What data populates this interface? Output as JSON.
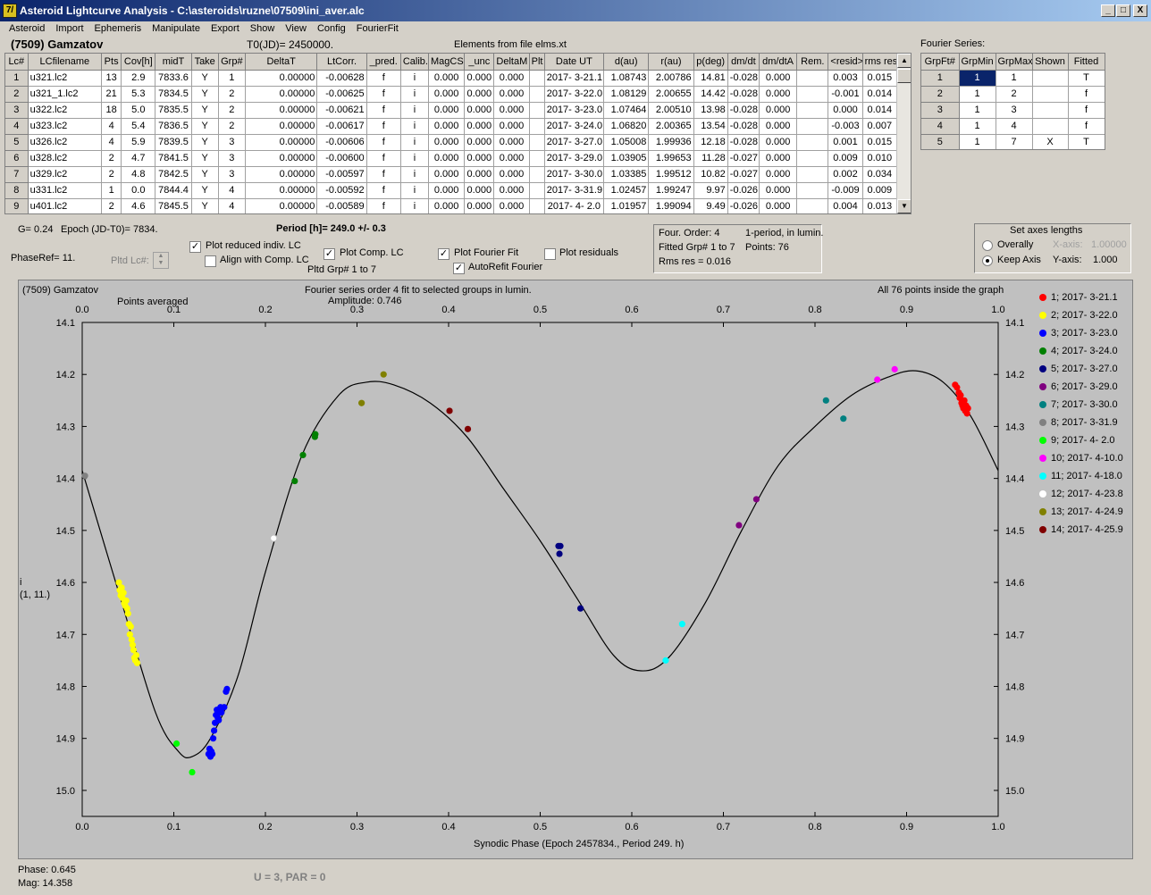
{
  "title": "Asteroid Lightcurve Analysis - C:\\asteroids\\ruzne\\07509\\ini_aver.alc",
  "app_icon": "7/",
  "window_buttons": [
    "_",
    "□",
    "X"
  ],
  "menu": [
    "Asteroid",
    "Import",
    "Ephemeris",
    "Manipulate",
    "Export",
    "Show",
    "View",
    "Config",
    "FourierFit"
  ],
  "asteroid_name": "(7509) Gamzatov",
  "t0": "T0(JD)= 2450000.",
  "elements": "Elements from file elms.xt",
  "fourier_series_label": "Fourier Series:",
  "lc_table": {
    "headers": [
      "Lc#",
      "LCfilename",
      "Pts",
      "Cov[h]",
      "midT",
      "Take",
      "Grp#",
      "DeltaT",
      "LtCorr.",
      "_pred.",
      "Calib.",
      "MagCS",
      "_unc",
      "DeltaM",
      "Plt",
      "Date UT",
      "d(au)",
      "r(au)",
      "p(deg)",
      "dm/dt",
      "dm/dtA",
      "Rem.",
      "<resid>",
      "rms res"
    ],
    "rows": [
      [
        "1",
        "u321.lc2",
        "13",
        "2.9",
        "7833.6",
        "Y",
        "1",
        "0.00000",
        "-0.00628",
        "f",
        "i",
        "0.000",
        "0.000",
        "0.000",
        "",
        "2017- 3-21.1",
        "1.08743",
        "2.00786",
        "14.81",
        "-0.028",
        "0.000",
        "",
        "0.003",
        "0.015"
      ],
      [
        "2",
        "u321_1.lc2",
        "21",
        "5.3",
        "7834.5",
        "Y",
        "2",
        "0.00000",
        "-0.00625",
        "f",
        "i",
        "0.000",
        "0.000",
        "0.000",
        "",
        "2017- 3-22.0",
        "1.08129",
        "2.00655",
        "14.42",
        "-0.028",
        "0.000",
        "",
        "-0.001",
        "0.014"
      ],
      [
        "3",
        "u322.lc2",
        "18",
        "5.0",
        "7835.5",
        "Y",
        "2",
        "0.00000",
        "-0.00621",
        "f",
        "i",
        "0.000",
        "0.000",
        "0.000",
        "",
        "2017- 3-23.0",
        "1.07464",
        "2.00510",
        "13.98",
        "-0.028",
        "0.000",
        "",
        "0.000",
        "0.014"
      ],
      [
        "4",
        "u323.lc2",
        "4",
        "5.4",
        "7836.5",
        "Y",
        "2",
        "0.00000",
        "-0.00617",
        "f",
        "i",
        "0.000",
        "0.000",
        "0.000",
        "",
        "2017- 3-24.0",
        "1.06820",
        "2.00365",
        "13.54",
        "-0.028",
        "0.000",
        "",
        "-0.003",
        "0.007"
      ],
      [
        "5",
        "u326.lc2",
        "4",
        "5.9",
        "7839.5",
        "Y",
        "3",
        "0.00000",
        "-0.00606",
        "f",
        "i",
        "0.000",
        "0.000",
        "0.000",
        "",
        "2017- 3-27.0",
        "1.05008",
        "1.99936",
        "12.18",
        "-0.028",
        "0.000",
        "",
        "0.001",
        "0.015"
      ],
      [
        "6",
        "u328.lc2",
        "2",
        "4.7",
        "7841.5",
        "Y",
        "3",
        "0.00000",
        "-0.00600",
        "f",
        "i",
        "0.000",
        "0.000",
        "0.000",
        "",
        "2017- 3-29.0",
        "1.03905",
        "1.99653",
        "11.28",
        "-0.027",
        "0.000",
        "",
        "0.009",
        "0.010"
      ],
      [
        "7",
        "u329.lc2",
        "2",
        "4.8",
        "7842.5",
        "Y",
        "3",
        "0.00000",
        "-0.00597",
        "f",
        "i",
        "0.000",
        "0.000",
        "0.000",
        "",
        "2017- 3-30.0",
        "1.03385",
        "1.99512",
        "10.82",
        "-0.027",
        "0.000",
        "",
        "0.002",
        "0.034"
      ],
      [
        "8",
        "u331.lc2",
        "1",
        "0.0",
        "7844.4",
        "Y",
        "4",
        "0.00000",
        "-0.00592",
        "f",
        "i",
        "0.000",
        "0.000",
        "0.000",
        "",
        "2017- 3-31.9",
        "1.02457",
        "1.99247",
        "9.97",
        "-0.026",
        "0.000",
        "",
        "-0.009",
        "0.009"
      ],
      [
        "9",
        "u401.lc2",
        "2",
        "4.6",
        "7845.5",
        "Y",
        "4",
        "0.00000",
        "-0.00589",
        "f",
        "i",
        "0.000",
        "0.000",
        "0.000",
        "",
        "2017- 4- 2.0",
        "1.01957",
        "1.99094",
        "9.49",
        "-0.026",
        "0.000",
        "",
        "0.004",
        "0.013"
      ]
    ]
  },
  "fourier_table": {
    "headers": [
      "GrpFt#",
      "GrpMin",
      "GrpMax",
      "Shown",
      "Fitted"
    ],
    "rows": [
      [
        "1",
        "1",
        "1",
        "",
        "T"
      ],
      [
        "2",
        "1",
        "2",
        "",
        "f"
      ],
      [
        "3",
        "1",
        "3",
        "",
        "f"
      ],
      [
        "4",
        "1",
        "4",
        "",
        "f"
      ],
      [
        "5",
        "1",
        "7",
        "X",
        "T"
      ]
    ]
  },
  "info": {
    "g": "G= 0.24",
    "epoch": "Epoch (JD-T0)= 7834.",
    "period": "Period [h]= 249.0 +/- 0.3",
    "phaseref": "PhaseRef= 11.",
    "pltd_lc": "Pltd Lc#:",
    "pltd_grp": "Pltd Grp#  1   to   7"
  },
  "checks": {
    "plot_reduced": {
      "label": "Plot reduced indiv. LC",
      "checked": true
    },
    "align": {
      "label": "Align with Comp. LC",
      "checked": false
    },
    "plot_comp": {
      "label": "Plot Comp. LC",
      "checked": true
    },
    "plot_fourier": {
      "label": "Plot Fourier Fit",
      "checked": true
    },
    "autorefit": {
      "label": "AutoRefit Fourier",
      "checked": true
    },
    "plot_resid": {
      "label": "Plot residuals",
      "checked": false
    }
  },
  "fit_info": {
    "order": "Four. Order:  4",
    "mode": "1-period, in lumin.",
    "fitted": "Fitted Grp# 1 to 7",
    "points": "Points: 76",
    "rms": "Rms res     = 0.016"
  },
  "axes": {
    "title": "Set axes lengths",
    "overally": "Overally",
    "keep": "Keep Axis",
    "xaxis_label": "X-axis:",
    "xaxis_val": "1.00000",
    "yaxis_label": "Y-axis:",
    "yaxis_val": "1.000"
  },
  "plot_header": {
    "name": "(7509) Gamzatov",
    "fourier": "Fourier series order 4 fit to selected groups in lumin.",
    "amplitude": "Amplitude: 0.746",
    "points_in": "All 76 points inside the graph",
    "averaged": "Points averaged"
  },
  "status": {
    "phase": "Phase:  0.645",
    "mag": "Mag:    14.358",
    "upar": "U = 3, PAR = 0"
  },
  "chart_data": {
    "type": "scatter",
    "xlabel": "Synodic Phase (Epoch 2457834., Period 249. h)",
    "ylabel": "i",
    "ylabel2": "(1, 11.)",
    "xlim": [
      0,
      1
    ],
    "ylim": [
      14.1,
      15.05
    ],
    "y_inverted": true,
    "x_ticks": [
      0,
      0.1,
      0.2,
      0.3,
      0.4,
      0.5,
      0.6,
      0.7,
      0.8,
      0.9,
      1.0
    ],
    "x_tick_labels": [
      "0.0",
      "0.1",
      "0.2",
      "0.3",
      "0.4",
      "0.5",
      "0.6",
      "0.7",
      "0.8",
      "0.9",
      "1.0"
    ],
    "y_ticks": [
      14.1,
      14.2,
      14.3,
      14.4,
      14.5,
      14.6,
      14.7,
      14.8,
      14.9,
      15.0
    ],
    "y_tick_labels": [
      "14.1",
      "14.2",
      "14.3",
      "14.4",
      "14.5",
      "14.6",
      "14.7",
      "14.8",
      "14.9",
      "15.0"
    ],
    "fit_curve": {
      "phase": [
        0,
        0.04,
        0.08,
        0.105,
        0.12,
        0.14,
        0.17,
        0.2,
        0.24,
        0.28,
        0.31,
        0.34,
        0.38,
        0.42,
        0.46,
        0.5,
        0.54,
        0.58,
        0.61,
        0.64,
        0.68,
        0.72,
        0.76,
        0.8,
        0.84,
        0.88,
        0.91,
        0.94,
        0.97,
        1.0
      ],
      "mag": [
        14.385,
        14.62,
        14.85,
        14.925,
        14.935,
        14.9,
        14.78,
        14.58,
        14.355,
        14.24,
        14.215,
        14.22,
        14.255,
        14.32,
        14.42,
        14.52,
        14.63,
        14.74,
        14.77,
        14.745,
        14.64,
        14.5,
        14.375,
        14.3,
        14.24,
        14.205,
        14.193,
        14.215,
        14.28,
        14.385
      ]
    },
    "series": [
      {
        "name": "1; 2017- 3-21.1",
        "color": "#ff0000",
        "x": [
          0.953,
          0.955,
          0.957,
          0.958,
          0.959,
          0.96,
          0.961,
          0.962,
          0.963,
          0.964,
          0.965,
          0.966,
          0.967
        ],
        "y": [
          14.22,
          14.225,
          14.235,
          14.245,
          14.24,
          14.255,
          14.26,
          14.265,
          14.25,
          14.27,
          14.26,
          14.275,
          14.265
        ]
      },
      {
        "name": "2; 2017- 3-22.0",
        "color": "#ffff00",
        "x": [
          0.04,
          0.041,
          0.042,
          0.043,
          0.044,
          0.045,
          0.046,
          0.047,
          0.048,
          0.049,
          0.05,
          0.051,
          0.052,
          0.053,
          0.054,
          0.055,
          0.056,
          0.057,
          0.058,
          0.059,
          0.06
        ],
        "y": [
          14.6,
          14.615,
          14.625,
          14.61,
          14.63,
          14.62,
          14.64,
          14.645,
          14.635,
          14.65,
          14.66,
          14.68,
          14.7,
          14.685,
          14.71,
          14.72,
          14.73,
          14.745,
          14.75,
          14.74,
          14.755
        ]
      },
      {
        "name": "3; 2017- 3-23.0",
        "color": "#0000ff",
        "x": [
          0.138,
          0.139,
          0.14,
          0.141,
          0.142,
          0.143,
          0.144,
          0.145,
          0.146,
          0.147,
          0.148,
          0.149,
          0.15,
          0.151,
          0.152,
          0.155,
          0.157,
          0.158
        ],
        "y": [
          14.93,
          14.92,
          14.935,
          14.925,
          14.93,
          14.9,
          14.885,
          14.87,
          14.855,
          14.845,
          14.86,
          14.865,
          14.85,
          14.84,
          14.85,
          14.84,
          14.81,
          14.805
        ]
      },
      {
        "name": "4; 2017- 3-24.0",
        "color": "#008000",
        "x": [
          0.232,
          0.241,
          0.254,
          0.2545
        ],
        "y": [
          14.405,
          14.355,
          14.32,
          14.315
        ]
      },
      {
        "name": "5; 2017- 3-27.0",
        "color": "#000080",
        "x": [
          0.52,
          0.521,
          0.522,
          0.544
        ],
        "y": [
          14.53,
          14.545,
          14.53,
          14.65
        ]
      },
      {
        "name": "6; 2017- 3-29.0",
        "color": "#800080",
        "x": [
          0.717,
          0.736
        ],
        "y": [
          14.49,
          14.44
        ]
      },
      {
        "name": "7; 2017- 3-30.0",
        "color": "#008080",
        "x": [
          0.812,
          0.831
        ],
        "y": [
          14.25,
          14.285
        ]
      },
      {
        "name": "8; 2017- 3-31.9",
        "color": "#808080",
        "x": [
          0.003
        ],
        "y": [
          14.395
        ]
      },
      {
        "name": "9; 2017- 4- 2.0",
        "color": "#00ff00",
        "x": [
          0.103,
          0.12
        ],
        "y": [
          14.91,
          14.965
        ]
      },
      {
        "name": "10; 2017- 4-10.0",
        "color": "#ff00ff",
        "x": [
          0.868,
          0.887
        ],
        "y": [
          14.21,
          14.19
        ]
      },
      {
        "name": "11; 2017- 4-18.0",
        "color": "#00ffff",
        "x": [
          0.637,
          0.655
        ],
        "y": [
          14.75,
          14.68
        ]
      },
      {
        "name": "12; 2017- 4-23.8",
        "color": "#ffffff",
        "x": [
          0.209
        ],
        "y": [
          14.515
        ]
      },
      {
        "name": "13; 2017- 4-24.9",
        "color": "#808000",
        "x": [
          0.305,
          0.329
        ],
        "y": [
          14.255,
          14.2
        ]
      },
      {
        "name": "14; 2017- 4-25.9",
        "color": "#800000",
        "x": [
          0.401,
          0.421
        ],
        "y": [
          14.27,
          14.305
        ]
      }
    ]
  }
}
